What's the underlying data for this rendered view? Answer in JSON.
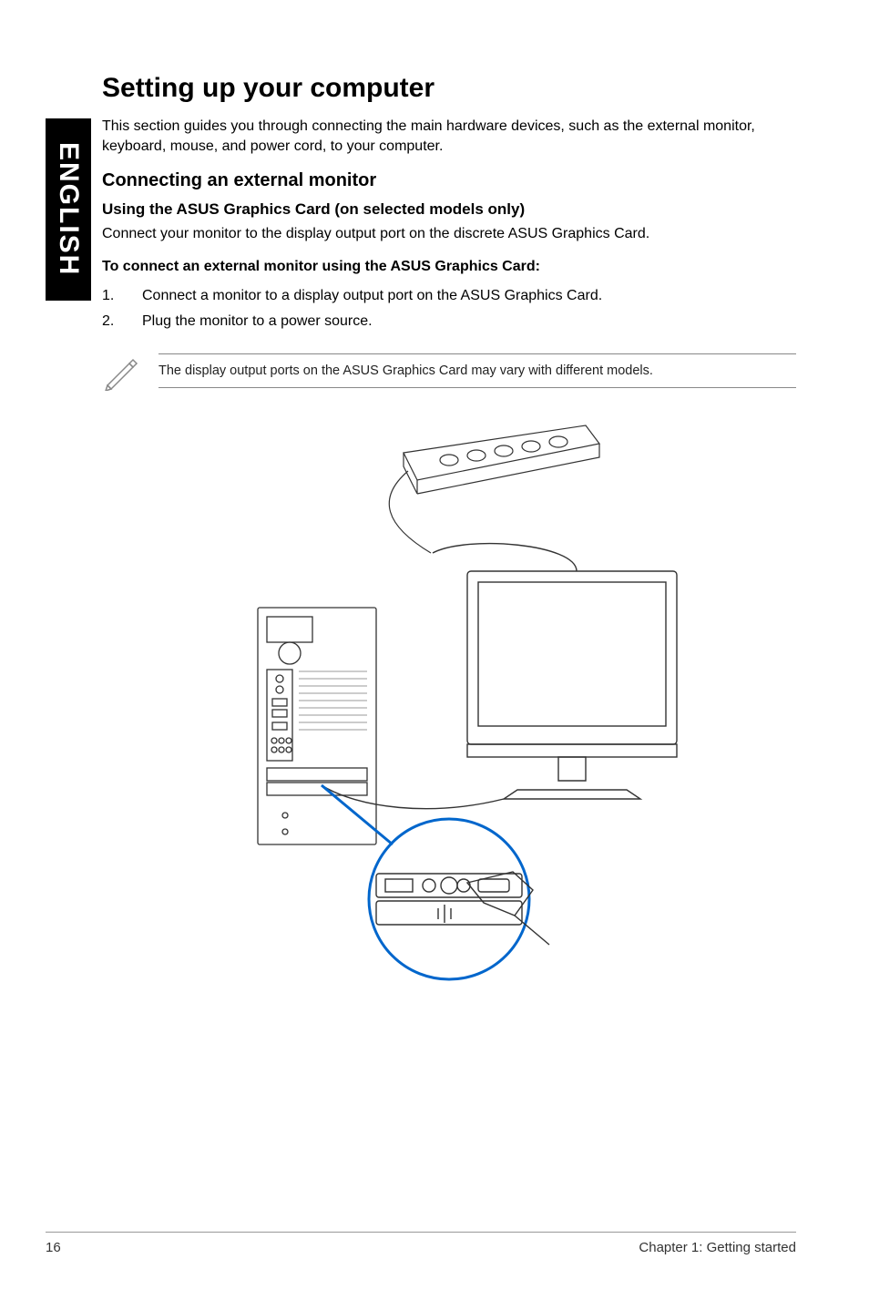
{
  "sidebar": {
    "label": "ENGLISH"
  },
  "heading": "Setting up your computer",
  "intro": "This section guides you through connecting the main hardware devices, such as the external monitor, keyboard, mouse, and power cord, to your computer.",
  "sub1": "Connecting an external monitor",
  "sub2": "Using the ASUS Graphics Card (on selected models only)",
  "body1": "Connect your monitor to the display output port on the discrete ASUS Graphics Card.",
  "bold_line": "To connect an external monitor using the ASUS Graphics Card:",
  "steps": [
    {
      "num": "1.",
      "text": "Connect a monitor to a display output port on the ASUS Graphics Card."
    },
    {
      "num": "2.",
      "text": "Plug the monitor to a power source."
    }
  ],
  "note": "The display output ports on the ASUS Graphics Card may vary with different models.",
  "footer": {
    "page": "16",
    "chapter": "Chapter 1: Getting started"
  }
}
